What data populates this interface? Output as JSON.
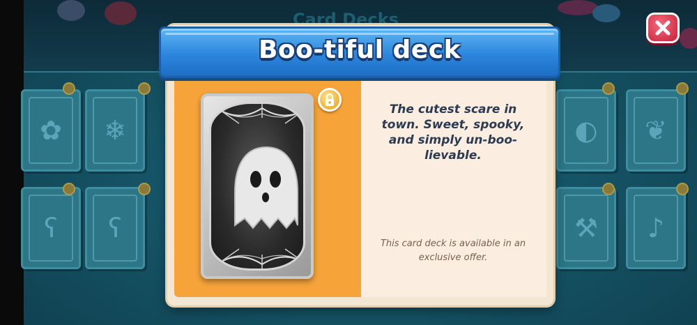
{
  "background": {
    "screen_title": "Card Decks"
  },
  "dialog": {
    "title": "Boo-tiful deck",
    "description": "The cutest scare in town. Sweet, spooky, and simply un-boo-lievable.",
    "availability": "This card deck is available in an exclusive offer.",
    "close_icon": "close-icon",
    "lock_icon": "lock-icon",
    "card_art": "ghost"
  },
  "colors": {
    "ribbon_blue": "#2c86dc",
    "panel_orange": "#f6a33a",
    "panel_cream": "#fbeee0",
    "close_red": "#d8263f",
    "lock_gold": "#e0a21a"
  }
}
